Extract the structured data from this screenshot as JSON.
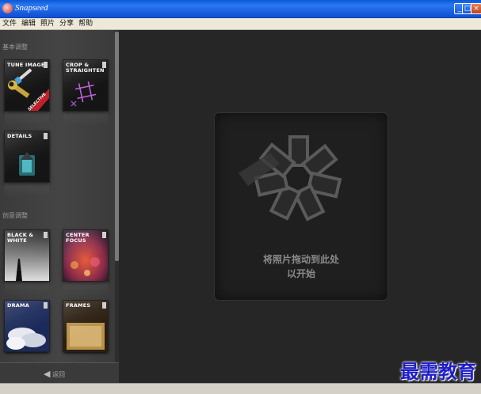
{
  "window": {
    "title": "Snapseed",
    "minimize": "_",
    "maximize": "□",
    "close": "×"
  },
  "menu": [
    "文件",
    "编辑",
    "照片",
    "分享",
    "帮助"
  ],
  "sidebar": {
    "basic_label": "基本调整",
    "creative_label": "创意调整",
    "basic_tiles": [
      {
        "label": "TUNE IMAGE",
        "badge": "SELECTIVE"
      },
      {
        "label": "CROP & STRAIGHTEN"
      },
      {
        "label": "DETAILS"
      }
    ],
    "creative_tiles": [
      {
        "label": "BLACK & WHITE"
      },
      {
        "label": "CENTER FOCUS"
      },
      {
        "label": "DRAMA"
      },
      {
        "label": "FRAMES"
      }
    ],
    "back_label": "返回"
  },
  "drop_zone": {
    "line1": "将照片拖动到此处",
    "line2": "以开始"
  },
  "watermark": "最需教育"
}
